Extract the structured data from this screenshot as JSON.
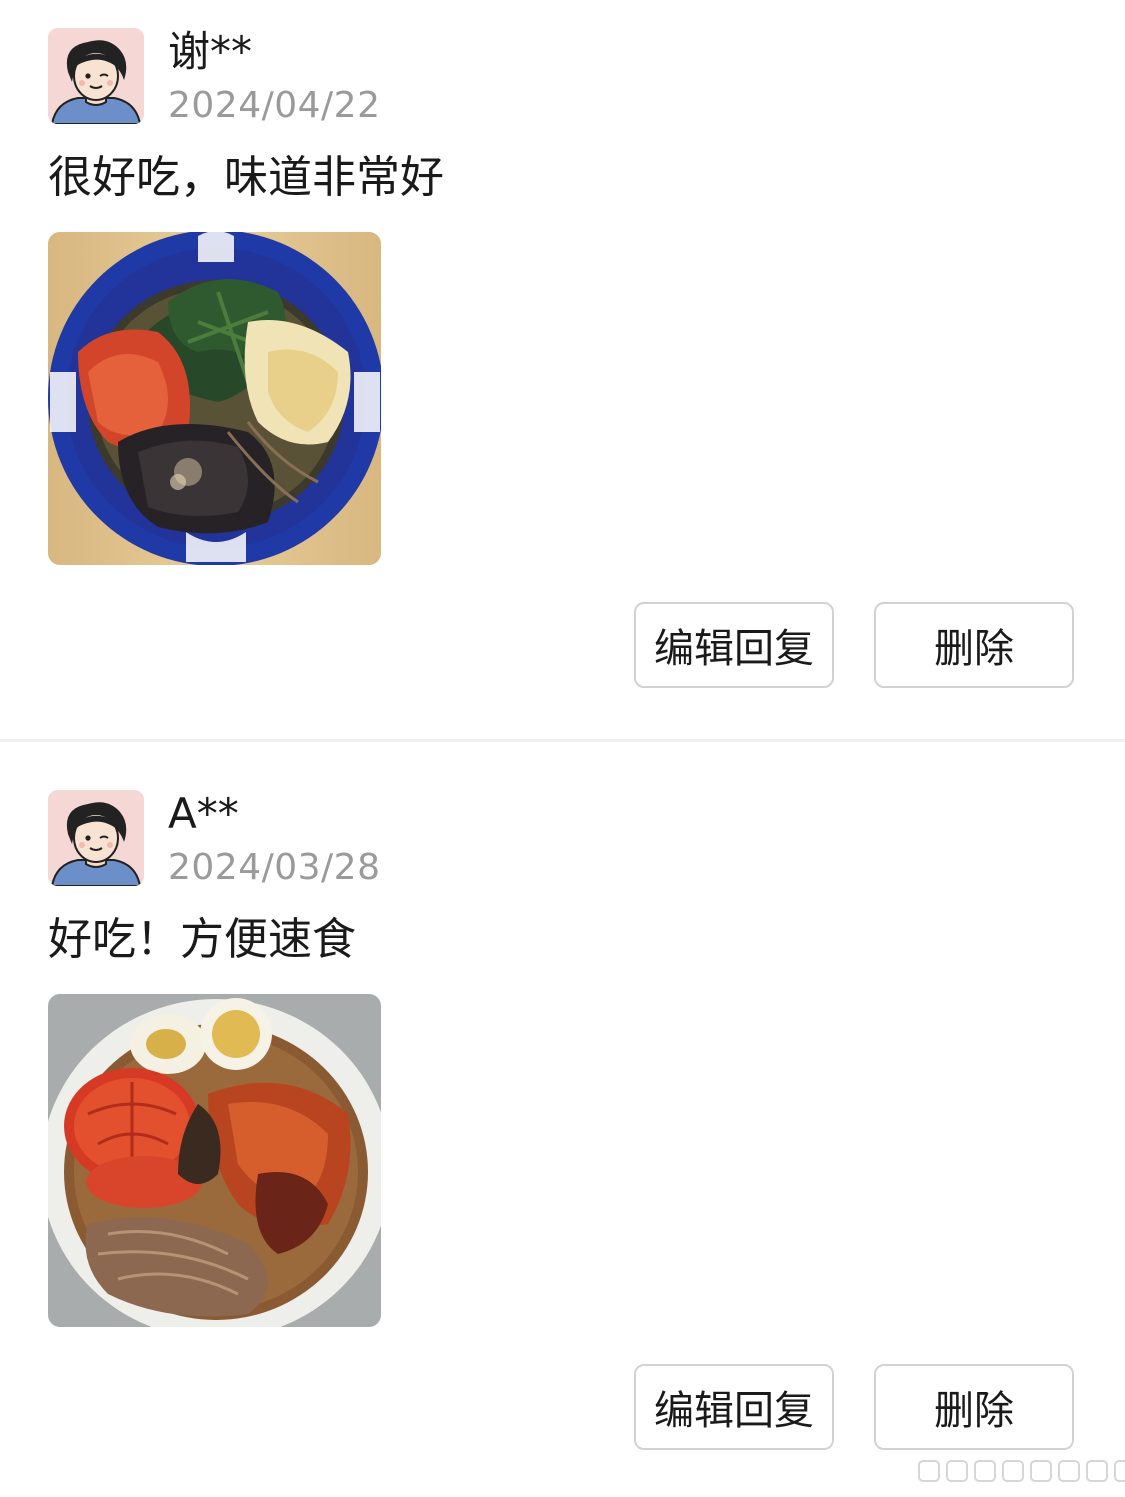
{
  "reviews": [
    {
      "username": "谢**",
      "date": "2024/04/22",
      "comment": "很好吃，味道非常好",
      "photo_subject": "cold noodles in blue bowl with spinach, kimchi and egg",
      "buttons": {
        "edit": "编辑回复",
        "delete": "删除"
      }
    },
    {
      "username": "A**",
      "date": "2024/03/28",
      "comment": "好吃！方便速食",
      "photo_subject": "cold noodles with tomato, boiled egg and kimchi in white bowl",
      "buttons": {
        "edit": "编辑回复",
        "delete": "删除"
      }
    }
  ],
  "colors": {
    "avatar_bg": "#f5d7d6",
    "date_text": "#9a9a9a",
    "button_border": "#d2d2d2"
  }
}
